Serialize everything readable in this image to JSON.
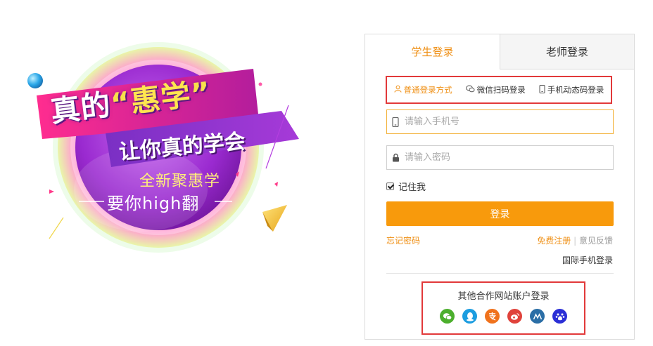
{
  "promo": {
    "title_line1_pre": "真的",
    "title_open_quote": "“",
    "title_emphasis": "惠学",
    "title_close_quote": "”",
    "title_line2": "让你真的学会",
    "slogan_line1": "全新聚惠学",
    "slogan_line2": "要你high翻"
  },
  "tabs": [
    {
      "label": "学生登录",
      "active": true
    },
    {
      "label": "老师登录",
      "active": false
    }
  ],
  "login_methods": [
    {
      "label": "普通登录方式",
      "icon": "user-icon",
      "active": true
    },
    {
      "label": "微信扫码登录",
      "icon": "wechat-icon",
      "active": false
    },
    {
      "label": "手机动态码登录",
      "icon": "mobile-icon",
      "active": false
    }
  ],
  "phone_field": {
    "placeholder": "请输入手机号",
    "value": "",
    "icon": "mobile-icon"
  },
  "password_field": {
    "placeholder": "请输入密码",
    "value": "",
    "icon": "lock-icon"
  },
  "remember_me": {
    "label": "记住我",
    "checked": true
  },
  "login_button": "登录",
  "links": {
    "forgot": "忘记密码",
    "register": "免费注册",
    "separator": "|",
    "feedback": "意见反馈",
    "international": "国际手机登录"
  },
  "partners": {
    "title": "其他合作网站账户登录",
    "icons": [
      {
        "name": "wechat-icon",
        "color": "#4caf2d"
      },
      {
        "name": "qq-icon",
        "color": "#1c9de0"
      },
      {
        "name": "alipay-icon",
        "color": "#f0721c"
      },
      {
        "name": "weibo-icon",
        "color": "#e0423b"
      },
      {
        "name": "renren-icon",
        "color": "#2b6ea6"
      },
      {
        "name": "baidu-icon",
        "color": "#2b2fd6"
      }
    ]
  },
  "colors": {
    "accent": "#ef8f14",
    "button": "#f89a0c",
    "highlight_border": "#e2393a"
  }
}
